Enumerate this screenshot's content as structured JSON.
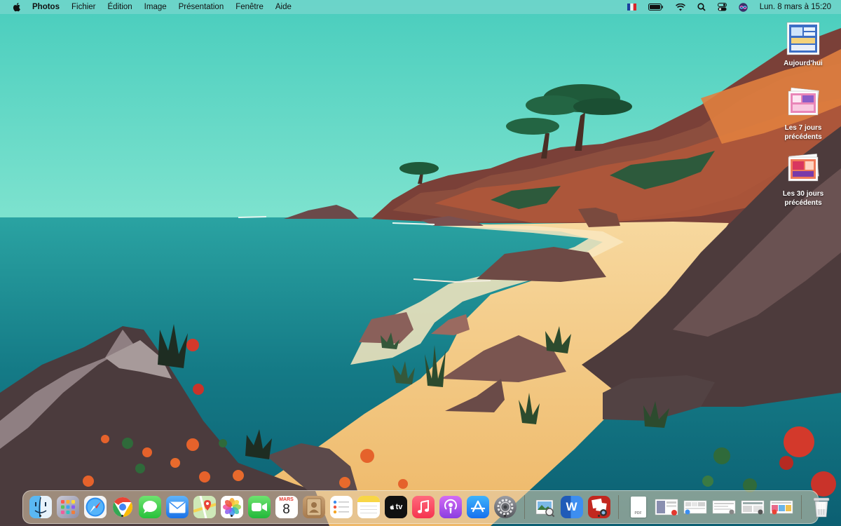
{
  "menubar": {
    "app_name": "Photos",
    "menus": [
      "Fichier",
      "Édition",
      "Image",
      "Présentation",
      "Fenêtre",
      "Aide"
    ],
    "clock": "Lun. 8 mars à  15:20",
    "status_icons": [
      "french-flag-icon",
      "battery-icon",
      "wifi-icon",
      "spotlight-search-icon",
      "control-center-icon",
      "siri-icon"
    ]
  },
  "desktop": {
    "stacks": [
      {
        "label": "Aujourd'hui"
      },
      {
        "label": "Les 7 jours précédents"
      },
      {
        "label": "Les 30 jours précédents"
      }
    ]
  },
  "dock": {
    "apps": [
      "Finder",
      "Launchpad",
      "Safari",
      "Chrome",
      "Messages",
      "Mail",
      "Plans",
      "Photos",
      "FaceTime",
      "Calendrier",
      "Contacts",
      "Rappels",
      "Notes",
      "TV",
      "Musique",
      "Podcasts",
      "App Store",
      "Préférences Système",
      "Aperçu",
      "Word",
      "Photo Booth"
    ],
    "calendar": {
      "month": "MARS",
      "day": "8"
    },
    "tv_label": "tv",
    "word_letter": "W",
    "doc_badge": "PDF"
  },
  "colors": {
    "sky": "#5fd8c4",
    "sea": "#1f8a92",
    "sand": "#f2c98a",
    "rock": "#5c4848"
  }
}
